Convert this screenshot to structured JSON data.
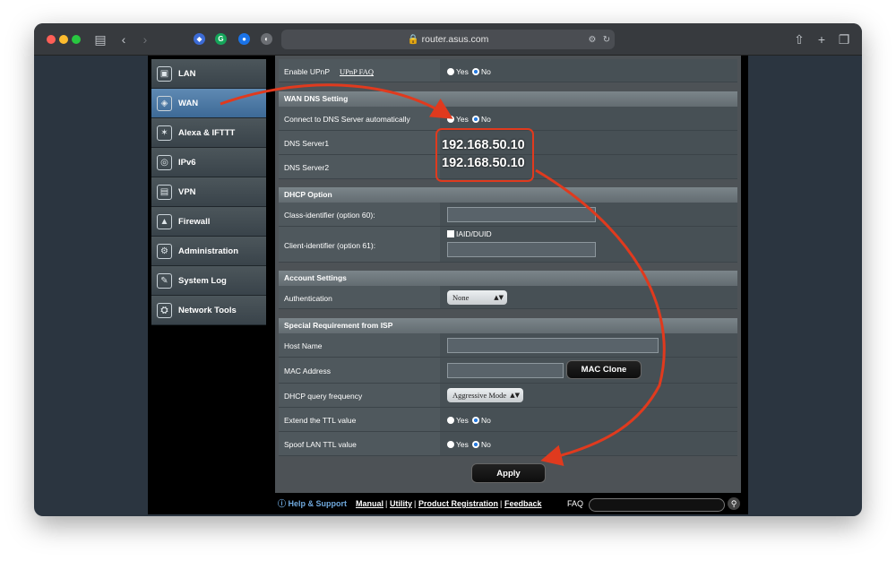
{
  "browser": {
    "url": "router.asus.com"
  },
  "sidebar": {
    "items": [
      {
        "label": "LAN",
        "icon": "lan-icon"
      },
      {
        "label": "WAN",
        "icon": "globe-icon"
      },
      {
        "label": "Alexa & IFTTT",
        "icon": "alexa-icon"
      },
      {
        "label": "IPv6",
        "icon": "ipv6-icon"
      },
      {
        "label": "VPN",
        "icon": "vpn-icon"
      },
      {
        "label": "Firewall",
        "icon": "fire-icon"
      },
      {
        "label": "Administration",
        "icon": "admin-icon"
      },
      {
        "label": "System Log",
        "icon": "log-icon"
      },
      {
        "label": "Network Tools",
        "icon": "tools-icon"
      }
    ],
    "active_index": 1
  },
  "upnp": {
    "label": "Enable UPnP",
    "faq_link": "UPnP FAQ",
    "yes": "Yes",
    "no": "No"
  },
  "wan_dns": {
    "heading": "WAN DNS Setting",
    "auto_label": "Connect to DNS Server automatically",
    "yes": "Yes",
    "no": "No",
    "dns1_label": "DNS Server1",
    "dns2_label": "DNS Server2",
    "dns1_value": "192.168.50.10",
    "dns2_value": "192.168.50.10"
  },
  "dhcp_option": {
    "heading": "DHCP Option",
    "class_label": "Class-identifier (option 60):",
    "client_label": "Client-identifier (option 61):",
    "iaid_label": "IAID/DUID"
  },
  "account": {
    "heading": "Account Settings",
    "auth_label": "Authentication",
    "auth_value": "None"
  },
  "isp": {
    "heading": "Special Requirement from ISP",
    "host_label": "Host Name",
    "mac_label": "MAC Address",
    "mac_clone": "MAC Clone",
    "dhcp_freq_label": "DHCP query frequency",
    "dhcp_freq_value": "Aggressive Mode",
    "ttl_label": "Extend the TTL value",
    "spoof_label": "Spoof LAN TTL value",
    "yes": "Yes",
    "no": "No"
  },
  "apply_label": "Apply",
  "footer": {
    "help": "Help & Support",
    "manual": "Manual",
    "utility": "Utility",
    "product_reg": "Product Registration",
    "feedback": "Feedback",
    "sep": "|",
    "faq": "FAQ"
  },
  "colors": {
    "annotation": "#e03a1e"
  }
}
